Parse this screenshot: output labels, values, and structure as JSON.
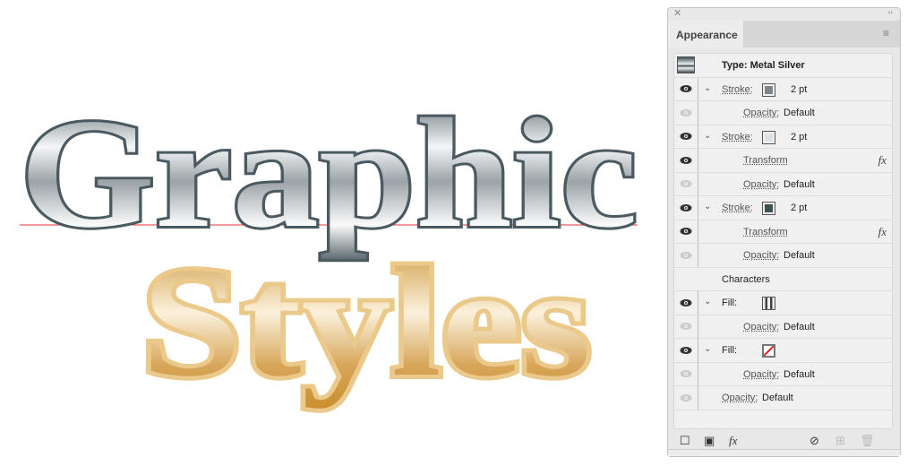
{
  "artwork": {
    "line1": "Graphic",
    "line2": "Styles",
    "colors": {
      "silver_stroke": "#4a5a60",
      "gold": "#d9a84f",
      "guide": "#ee3333"
    }
  },
  "panel": {
    "title": "Appearance",
    "header": "Type: Metal Silver",
    "rows": [
      {
        "kind": "stroke",
        "label": "Stroke:",
        "value": "2 pt",
        "swatch": "#7c858b",
        "visible": true
      },
      {
        "kind": "opacity",
        "label": "Opacity:",
        "value": "Default",
        "visible": false
      },
      {
        "kind": "stroke",
        "label": "Stroke:",
        "value": "2 pt",
        "swatch": "#dde2e6",
        "visible": true
      },
      {
        "kind": "effect",
        "label": "Transform",
        "visible": true
      },
      {
        "kind": "opacity",
        "label": "Opacity:",
        "value": "Default",
        "visible": false
      },
      {
        "kind": "stroke",
        "label": "Stroke:",
        "value": "2 pt",
        "swatch": "#3c4f55",
        "visible": true
      },
      {
        "kind": "effect",
        "label": "Transform",
        "visible": true
      },
      {
        "kind": "opacity",
        "label": "Opacity:",
        "value": "Default",
        "visible": false
      }
    ],
    "characters": "Characters",
    "rows2": [
      {
        "kind": "fill",
        "label": "Fill:",
        "visible": true,
        "swatch": "gradient"
      },
      {
        "kind": "opacity",
        "label": "Opacity:",
        "value": "Default",
        "visible": false
      },
      {
        "kind": "fill",
        "label": "Fill:",
        "visible": true,
        "swatch": "none"
      },
      {
        "kind": "opacity",
        "label": "Opacity:",
        "value": "Default",
        "visible": false
      },
      {
        "kind": "opacity-top",
        "label": "Opacity:",
        "value": "Default",
        "visible": false
      }
    ],
    "fx_symbol": "fx"
  }
}
